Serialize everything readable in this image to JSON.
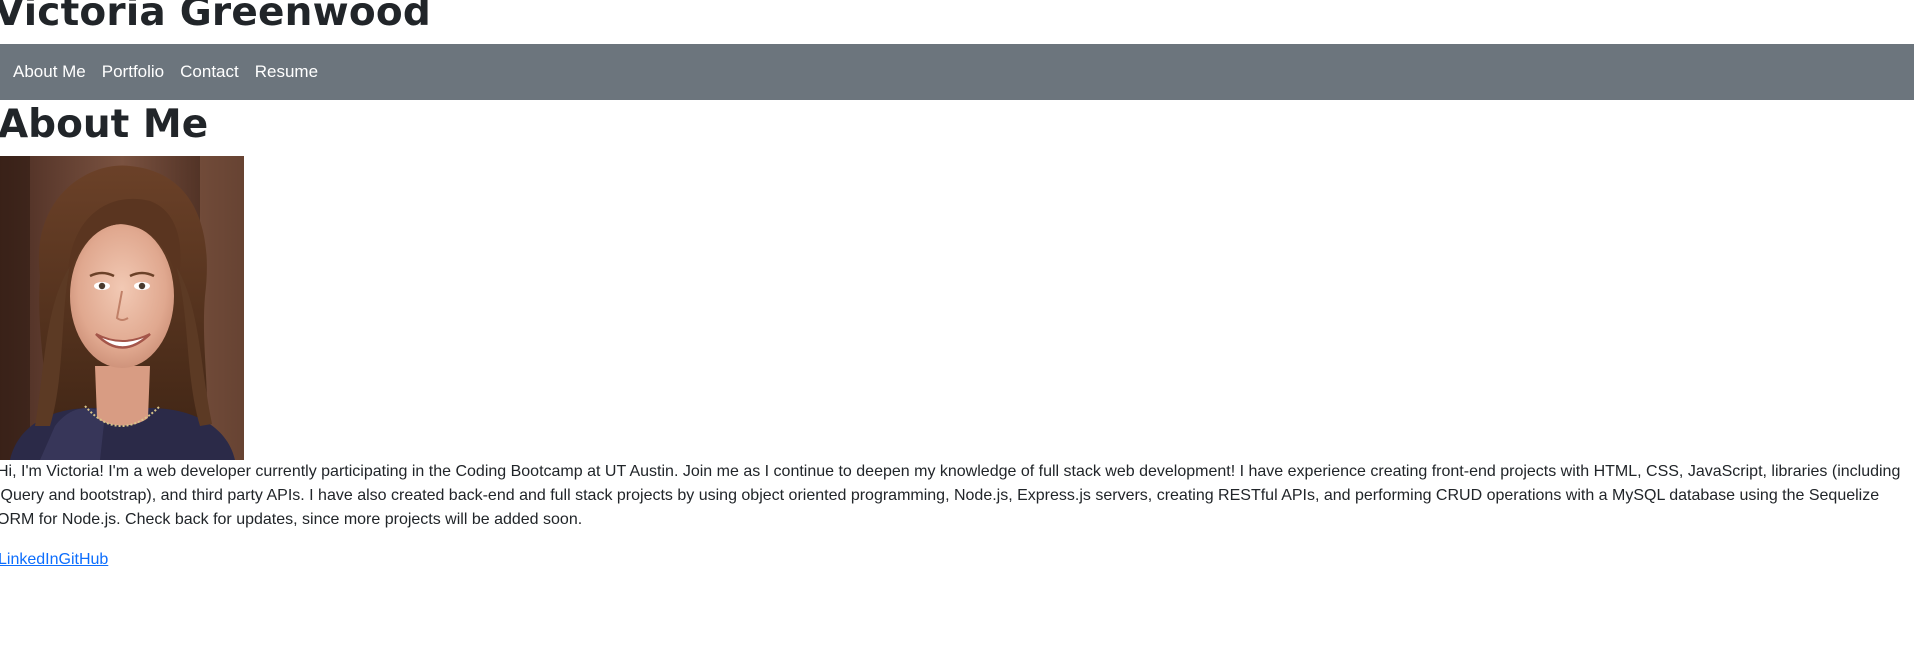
{
  "header": {
    "site_title": "Victoria Greenwood"
  },
  "nav": {
    "items": [
      {
        "label": "About Me"
      },
      {
        "label": "Portfolio"
      },
      {
        "label": "Contact"
      },
      {
        "label": "Resume"
      }
    ]
  },
  "main": {
    "heading": "About Me",
    "bio": "Hi, I'm Victoria! I'm a web developer currently participating in the Coding Bootcamp at UT Austin. Join me as I continue to deepen my knowledge of full stack web development! I have experience creating front-end projects with HTML, CSS, JavaScript, libraries (including jQuery and bootstrap), and third party APIs. I have also created back-end and full stack projects by using object oriented programming, Node.js, Express.js servers, creating RESTful APIs, and performing CRUD operations with a MySQL database using the Sequelize ORM for Node.js. Check back for updates, since more projects will be added soon.",
    "links": [
      {
        "label": "LinkedIn"
      },
      {
        "label": "GitHub"
      }
    ]
  },
  "colors": {
    "navbar_bg": "#6c757d",
    "link": "#0d6efd",
    "text": "#212529"
  }
}
